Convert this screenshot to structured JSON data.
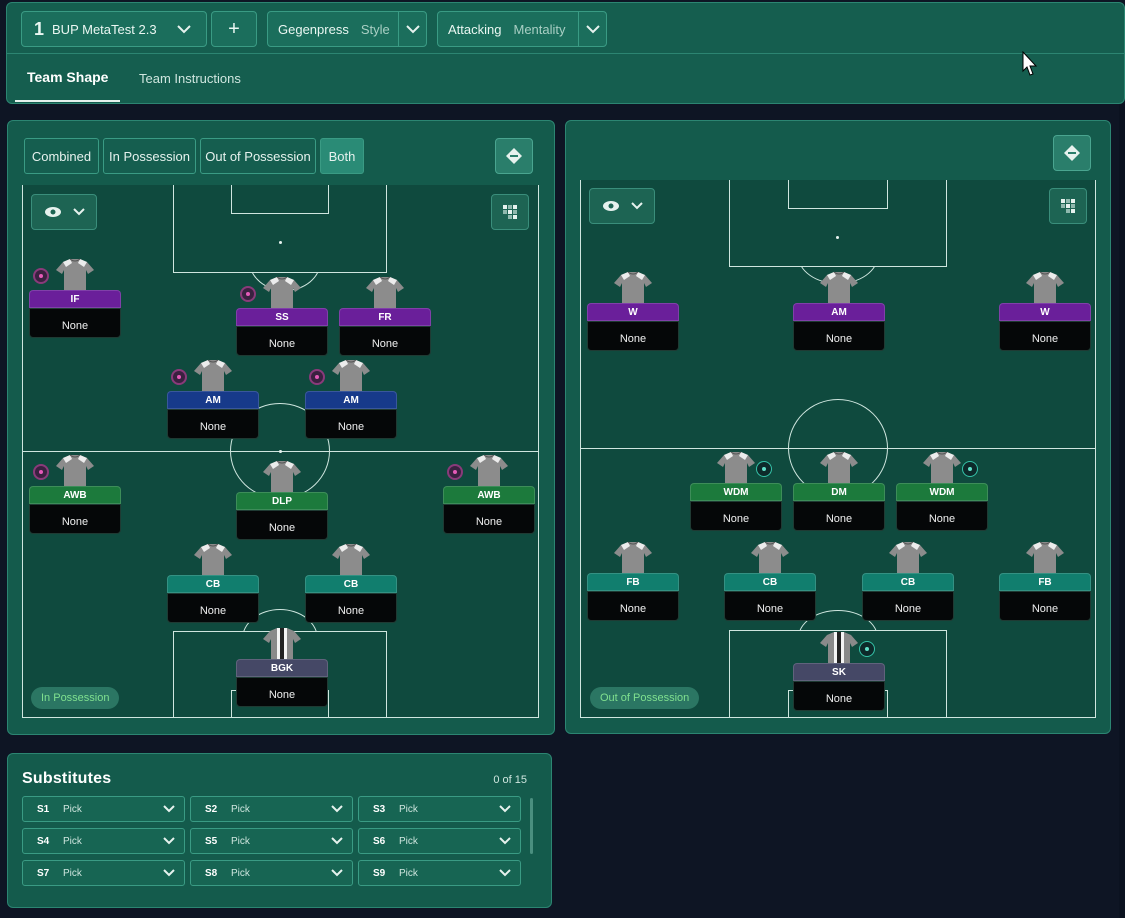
{
  "topbar": {
    "tactic_number": "1",
    "tactic_name": "BUP MetaTest 2.3",
    "add_label": "+",
    "style_value": "Gegenpress",
    "style_label": "Style",
    "mentality_value": "Attacking",
    "mentality_label": "Mentality",
    "tabs": [
      {
        "label": "Team Shape",
        "active": true
      },
      {
        "label": "Team Instructions",
        "active": false
      }
    ]
  },
  "view_modes": [
    {
      "label": "Combined",
      "active": false
    },
    {
      "label": "In Possession",
      "active": false
    },
    {
      "label": "Out of Possession",
      "active": false
    },
    {
      "label": "Both",
      "active": true
    }
  ],
  "left_pitch": {
    "badge": "In Possession",
    "players": [
      {
        "role": "IF",
        "duty": "None",
        "color": "purple",
        "indicator": "pink"
      },
      {
        "role": "SS",
        "duty": "None",
        "color": "purple",
        "indicator": "pink"
      },
      {
        "role": "FR",
        "duty": "None",
        "color": "purple",
        "indicator": ""
      },
      {
        "role": "AM",
        "duty": "None",
        "color": "blue",
        "indicator": "pink"
      },
      {
        "role": "AM",
        "duty": "None",
        "color": "blue",
        "indicator": "pink"
      },
      {
        "role": "AWB",
        "duty": "None",
        "color": "green",
        "indicator": "pink"
      },
      {
        "role": "DLP",
        "duty": "None",
        "color": "green",
        "indicator": ""
      },
      {
        "role": "AWB",
        "duty": "None",
        "color": "green",
        "indicator": "pink"
      },
      {
        "role": "CB",
        "duty": "None",
        "color": "teal",
        "indicator": ""
      },
      {
        "role": "CB",
        "duty": "None",
        "color": "teal",
        "indicator": ""
      },
      {
        "role": "BGK",
        "duty": "None",
        "color": "slate",
        "indicator": ""
      }
    ]
  },
  "right_pitch": {
    "badge": "Out of Possession",
    "players": [
      {
        "role": "W",
        "duty": "None",
        "color": "purple",
        "indicator": ""
      },
      {
        "role": "AM",
        "duty": "None",
        "color": "purple",
        "indicator": ""
      },
      {
        "role": "W",
        "duty": "None",
        "color": "purple",
        "indicator": ""
      },
      {
        "role": "WDM",
        "duty": "None",
        "color": "green",
        "indicator": "cyan"
      },
      {
        "role": "DM",
        "duty": "None",
        "color": "green",
        "indicator": ""
      },
      {
        "role": "WDM",
        "duty": "None",
        "color": "green",
        "indicator": "cyan"
      },
      {
        "role": "FB",
        "duty": "None",
        "color": "teal",
        "indicator": ""
      },
      {
        "role": "CB",
        "duty": "None",
        "color": "teal",
        "indicator": ""
      },
      {
        "role": "CB",
        "duty": "None",
        "color": "teal",
        "indicator": ""
      },
      {
        "role": "FB",
        "duty": "None",
        "color": "teal",
        "indicator": ""
      },
      {
        "role": "SK",
        "duty": "None",
        "color": "slate",
        "indicator": "cyan"
      }
    ]
  },
  "substitutes": {
    "title": "Substitutes",
    "count": "0 of 15",
    "slots": [
      {
        "id": "S1",
        "value": "Pick"
      },
      {
        "id": "S2",
        "value": "Pick"
      },
      {
        "id": "S3",
        "value": "Pick"
      },
      {
        "id": "S4",
        "value": "Pick"
      },
      {
        "id": "S5",
        "value": "Pick"
      },
      {
        "id": "S6",
        "value": "Pick"
      },
      {
        "id": "S7",
        "value": "Pick"
      },
      {
        "id": "S8",
        "value": "Pick"
      },
      {
        "id": "S9",
        "value": "Pick"
      }
    ]
  },
  "icons": [
    "chevron-down-icon",
    "plus-icon",
    "eye-icon",
    "grid-icon",
    "swap-pitch-icon",
    "shirt-icon",
    "cursor-icon"
  ]
}
